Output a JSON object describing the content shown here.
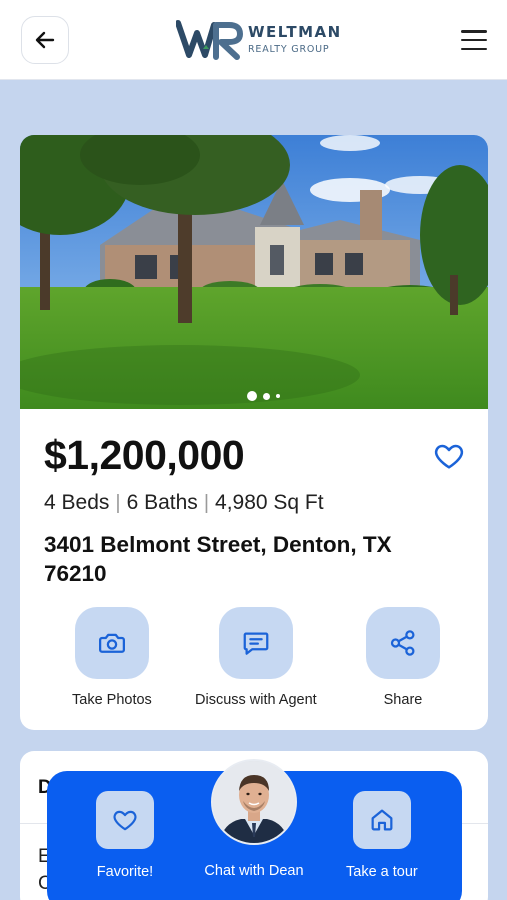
{
  "header": {
    "back_icon": "arrow-left-icon",
    "logo": {
      "name": "WELTMAN",
      "subtitle": "REALTY GROUP",
      "mark": "WR"
    },
    "menu_icon": "hamburger-menu-icon"
  },
  "listing": {
    "photo_carousel": {
      "slides": 3,
      "active_slide": 1
    },
    "price": "$1,200,000",
    "favorite_icon": "heart-outline-icon",
    "specs": {
      "beds": "4 Beds",
      "baths": "6 Baths",
      "sqft": "4,980 Sq Ft",
      "separator": "|"
    },
    "address": "3401 Belmont Street, Denton, TX 76210",
    "actions": [
      {
        "label": "Take Photos",
        "icon": "camera-icon"
      },
      {
        "label": "Discuss with Agent",
        "icon": "chat-message-icon"
      },
      {
        "label": "Share",
        "icon": "share-icon"
      }
    ]
  },
  "details_card": {
    "title_visible": "D",
    "text_line1": "E",
    "text_line2": "C"
  },
  "bottom_bar": {
    "favorite": {
      "label": "Favorite!",
      "icon": "heart-outline-icon"
    },
    "chat": {
      "label": "Chat with Dean",
      "icon": "agent-avatar"
    },
    "tour": {
      "label": "Take a tour",
      "icon": "home-icon"
    }
  },
  "colors": {
    "page_background": "#c5d5ee",
    "accent_blue": "#0a5ef0",
    "icon_tile": "#c6d8f2",
    "icon_stroke": "#1b63d8",
    "logo_navy": "#2d4a66"
  }
}
